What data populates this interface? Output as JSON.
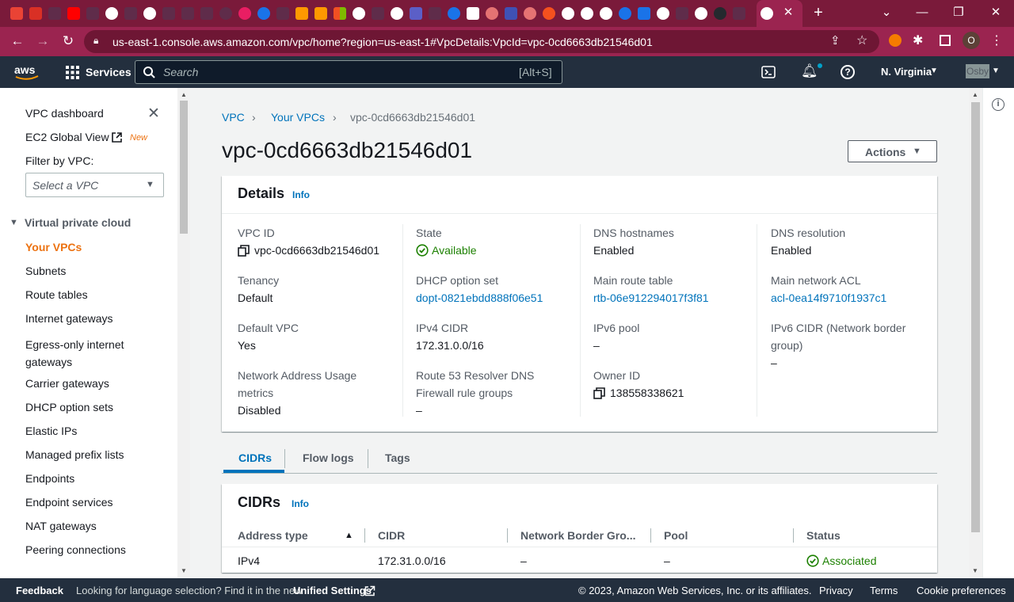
{
  "browser": {
    "url": "us-east-1.console.aws.amazon.com/vpc/home?region=us-east-1#VpcDetails:VpcId=vpc-0cd6663db21546d01",
    "profile_initial": "O"
  },
  "topnav": {
    "search_placeholder": "Search",
    "search_shortcut": "[Alt+S]",
    "services_label": "Services",
    "region_label": "N. Virginia",
    "account_label": "Osby"
  },
  "sidebar": {
    "top_items": [
      {
        "label": "VPC dashboard"
      },
      {
        "label": "EC2 Global View",
        "badge": "New"
      }
    ],
    "filter_label": "Filter by VPC:",
    "filter_placeholder": "Select a VPC",
    "section_title": "Virtual private cloud",
    "items": [
      {
        "label": "Your VPCs",
        "active": true
      },
      {
        "label": "Subnets"
      },
      {
        "label": "Route tables"
      },
      {
        "label": "Internet gateways"
      },
      {
        "label": "Egress-only internet gateways"
      },
      {
        "label": "Carrier gateways"
      },
      {
        "label": "DHCP option sets"
      },
      {
        "label": "Elastic IPs"
      },
      {
        "label": "Managed prefix lists"
      },
      {
        "label": "Endpoints"
      },
      {
        "label": "Endpoint services"
      },
      {
        "label": "NAT gateways"
      },
      {
        "label": "Peering connections"
      }
    ]
  },
  "breadcrumb": [
    "VPC",
    "Your VPCs",
    "vpc-0cd6663db21546d01"
  ],
  "page_title": "vpc-0cd6663db21546d01",
  "actions_label": "Actions",
  "details": {
    "title": "Details",
    "info_label": "Info",
    "fields": {
      "vpc_id": {
        "label": "VPC ID",
        "value": "vpc-0cd6663db21546d01"
      },
      "state": {
        "label": "State",
        "value": "Available"
      },
      "dns_hostnames": {
        "label": "DNS hostnames",
        "value": "Enabled"
      },
      "dns_resolution": {
        "label": "DNS resolution",
        "value": "Enabled"
      },
      "tenancy": {
        "label": "Tenancy",
        "value": "Default"
      },
      "dhcp_option_set": {
        "label": "DHCP option set",
        "value": "dopt-0821ebdd888f06e51"
      },
      "main_route_table": {
        "label": "Main route table",
        "value": "rtb-06e912294017f3f81"
      },
      "main_network_acl": {
        "label": "Main network ACL",
        "value": "acl-0ea14f9710f1937c1"
      },
      "default_vpc": {
        "label": "Default VPC",
        "value": "Yes"
      },
      "ipv4_cidr": {
        "label": "IPv4 CIDR",
        "value": "172.31.0.0/16"
      },
      "ipv6_pool": {
        "label": "IPv6 pool",
        "value": "–"
      },
      "ipv6_cidr": {
        "label_line1": "IPv6 CIDR (Network border",
        "label_line2": "group)",
        "value": "–"
      },
      "nau_metrics": {
        "label_line1": "Network Address Usage",
        "label_line2": "metrics",
        "value": "Disabled"
      },
      "route53": {
        "label_line1": "Route 53 Resolver DNS",
        "label_line2": "Firewall rule groups",
        "value": "–"
      },
      "owner_id": {
        "label": "Owner ID",
        "value": "138558338621"
      }
    }
  },
  "tabs": [
    {
      "label": "CIDRs",
      "active": true
    },
    {
      "label": "Flow logs"
    },
    {
      "label": "Tags"
    }
  ],
  "cidrs": {
    "title": "CIDRs",
    "info_label": "Info",
    "columns": [
      "Address type",
      "CIDR",
      "Network Border Gro...",
      "Pool",
      "Status"
    ],
    "rows": [
      {
        "address_type": "IPv4",
        "cidr": "172.31.0.0/16",
        "network_border_group": "–",
        "pool": "–",
        "status": "Associated"
      }
    ]
  },
  "footer": {
    "feedback": "Feedback",
    "lang_text": "Looking for language selection? Find it in the new",
    "unified_settings": "Unified Settings",
    "copyright": "© 2023, Amazon Web Services, Inc. or its affiliates.",
    "privacy": "Privacy",
    "terms": "Terms",
    "cookies": "Cookie preferences"
  },
  "colors": {
    "link": "#0073bb",
    "active_nav": "#ec7211",
    "success": "#1d8102",
    "aws_nav": "#232f3e",
    "browser_frame": "#9b2450"
  }
}
